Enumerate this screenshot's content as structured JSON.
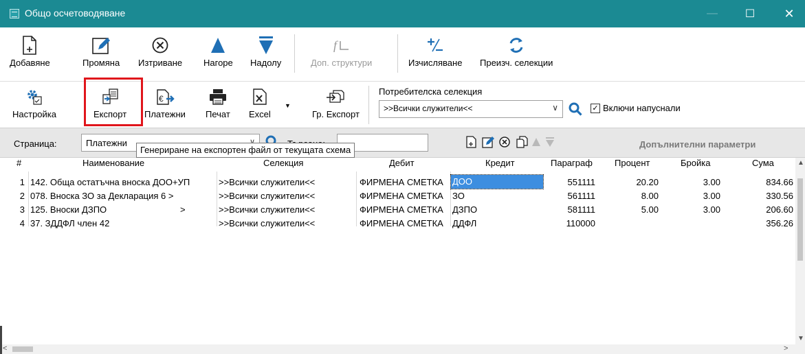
{
  "window": {
    "title": "Общо осчетоводяване",
    "minimize": "—",
    "maximize": "☐",
    "close": "✕"
  },
  "toolbar1": {
    "add": "Добавяне",
    "edit": "Промяна",
    "delete": "Изтриване",
    "up": "Нагоре",
    "down": "Надолу",
    "extra_structures": "Доп. структури",
    "calculate": "Изчисляване",
    "recalc_selections": "Преизч. селекции"
  },
  "toolbar2": {
    "settings": "Настройка",
    "export": "Експорт",
    "payments": "Платежни",
    "print": "Печат",
    "excel": "Excel",
    "group_export": "Гр. Експорт"
  },
  "user_selection": {
    "caption": "Потребителска селекция",
    "value": ">>Всички служители<<",
    "include_terminated_label": "Включи напуснали",
    "include_terminated_checked": true
  },
  "filterbar": {
    "page_label": "Страница:",
    "page_value": "Платежни",
    "find_label": "Търсене:",
    "find_value": "",
    "extra_params": "Допълнителни параметри"
  },
  "tooltip": "Генериране на експортен файл от текущата схема",
  "table": {
    "headers": [
      "#",
      "Наименование",
      "Селекция",
      "Дебит",
      "Кредит",
      "Параграф",
      "Процент",
      "Бройка",
      "Сума"
    ],
    "rows": [
      {
        "n": "1",
        "name": "142. Обща остатъчна вноска ДОО+УП",
        "sel": ">>Всички служители<<",
        "debit": "ФИРМЕНА СМЕТКА",
        "credit": "ДОО",
        "par": "551111",
        "pct": "20.20",
        "cnt": "3.00",
        "sum": "834.66"
      },
      {
        "n": "2",
        "name": "078. Вноска ЗО за Декларация 6 >",
        "sel": ">>Всички служители<<",
        "debit": "ФИРМЕНА СМЕТКА",
        "credit": "ЗО",
        "par": "561111",
        "pct": "8.00",
        "cnt": "3.00",
        "sum": "330.56"
      },
      {
        "n": "3",
        "name": "125. Вноски ДЗПО",
        "name_suffix": ">",
        "sel": ">>Всички служители<<",
        "debit": "ФИРМЕНА СМЕТКА",
        "credit": "ДЗПО",
        "par": "581111",
        "pct": "5.00",
        "cnt": "3.00",
        "sum": "206.60"
      },
      {
        "n": "4",
        "name": "37. ЗДДФЛ член 42",
        "sel": ">>Всички служители<<",
        "debit": "ФИРМЕНА СМЕТКА",
        "credit": "ДДФЛ",
        "par": "110000",
        "pct": "",
        "cnt": "",
        "sum": "356.26"
      }
    ]
  },
  "colors": {
    "titlebar": "#1b8a93",
    "highlight": "#e0151b",
    "selection": "#3d8ee0",
    "accent_blue": "#1f6fb5"
  }
}
